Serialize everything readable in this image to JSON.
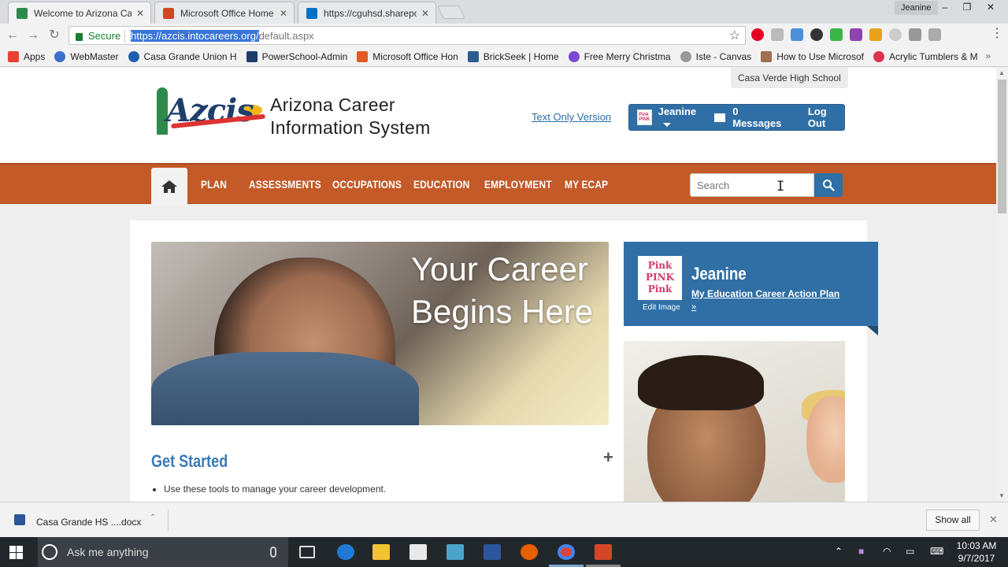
{
  "browser": {
    "tabs": [
      {
        "title": "Welcome to Arizona Career",
        "active": true,
        "icon_color": "#2e8a4a"
      },
      {
        "title": "Microsoft Office Home",
        "active": false,
        "icon_color": "#d24726"
      },
      {
        "title": "https://cguhsd.sharepoint",
        "active": false,
        "icon_color": "#0072c6"
      }
    ],
    "user": "Jeanine",
    "window_controls": [
      "–",
      "❐",
      "✕"
    ],
    "address": {
      "secure_label": "Secure",
      "url_selected": "https://azcis.intocareers.org/",
      "url_rest": "default.aspx"
    },
    "bookmarks": [
      {
        "label": "Apps",
        "color": "#e94235"
      },
      {
        "label": "WebMaster",
        "color": "#3c6ecc"
      },
      {
        "label": "Casa Grande Union H",
        "color": "#1f5fb0"
      },
      {
        "label": "PowerSchool-Admin",
        "color": "#1d3d6b"
      },
      {
        "label": "Microsoft Office Hon",
        "color": "#e25a23"
      },
      {
        "label": "BrickSeek | Home",
        "color": "#2c5c8f"
      },
      {
        "label": "Free Merry Christma",
        "color": "#7a4bd6"
      },
      {
        "label": "Iste - Canvas",
        "color": "#999999"
      },
      {
        "label": "How to Use Microsof",
        "color": "#a07050"
      },
      {
        "label": "Acrylic Tumblers & M",
        "color": "#e03050"
      }
    ],
    "bookmarks_more": "»"
  },
  "site": {
    "school": "Casa Verde High School",
    "logo": {
      "mark": "Azcis",
      "line1": "Arizona Career",
      "line2": "Information System"
    },
    "text_only": "Text Only Version",
    "user_bar": {
      "name": "Jeanine",
      "messages": "0 Messages",
      "logout": "Log Out"
    },
    "nav": [
      "PLAN",
      "ASSESSMENTS",
      "OCCUPATIONS",
      "EDUCATION",
      "EMPLOYMENT",
      "MY ECAP"
    ],
    "search_placeholder": "Search",
    "hero": {
      "line1": "Your Career",
      "line2": "Begins Here"
    },
    "get_started": {
      "title": "Get Started",
      "items": [
        "Use these tools to manage your career development."
      ]
    },
    "profile": {
      "name": "Jeanine",
      "img_text": [
        "Pink",
        "PINK",
        "Pink"
      ],
      "edit_image": "Edit Image",
      "link": "My Education Career Action Plan",
      "arrow": "»"
    }
  },
  "downloads": {
    "file": "Casa Grande HS ....docx",
    "show_all": "Show all"
  },
  "taskbar": {
    "search_placeholder": "Ask me anything",
    "time": "10:03 AM",
    "date": "9/7/2017"
  }
}
